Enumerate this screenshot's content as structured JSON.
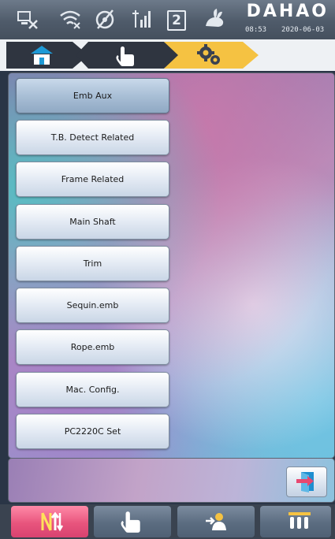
{
  "status_bar": {
    "icons": [
      "network-icon",
      "wifi-icon",
      "satellite-icon",
      "needle-stats-icon",
      "rabbit-icon"
    ],
    "counter": "2",
    "brand": "DAHAO",
    "time": "08:53",
    "date": "2020-06-03"
  },
  "breadcrumb": {
    "items": [
      "home-icon",
      "hand-icon",
      "gears-icon"
    ],
    "active_index": 2
  },
  "menu": {
    "items": [
      {
        "label": "Emb Aux",
        "selected": true
      },
      {
        "label": "T.B. Detect Related",
        "selected": false
      },
      {
        "label": "Frame Related",
        "selected": false
      },
      {
        "label": "Main Shaft",
        "selected": false
      },
      {
        "label": "Trim",
        "selected": false
      },
      {
        "label": "Sequin.emb",
        "selected": false
      },
      {
        "label": "Rope.emb",
        "selected": false
      },
      {
        "label": "Mac. Config.",
        "selected": false
      },
      {
        "label": "PC2220C Set",
        "selected": false
      }
    ]
  },
  "action_panel": {
    "exit_icon": "exit-door-icon"
  },
  "toolbar": {
    "buttons": [
      {
        "icon": "needle-switch-icon",
        "active": true
      },
      {
        "icon": "hand-pointer-icon",
        "active": false
      },
      {
        "icon": "frame-origin-icon",
        "active": false
      },
      {
        "icon": "needle-bars-icon",
        "active": false
      }
    ]
  },
  "colors": {
    "accent_breadcrumb": "#f5c242",
    "toolbar_active": "#e8557d"
  }
}
